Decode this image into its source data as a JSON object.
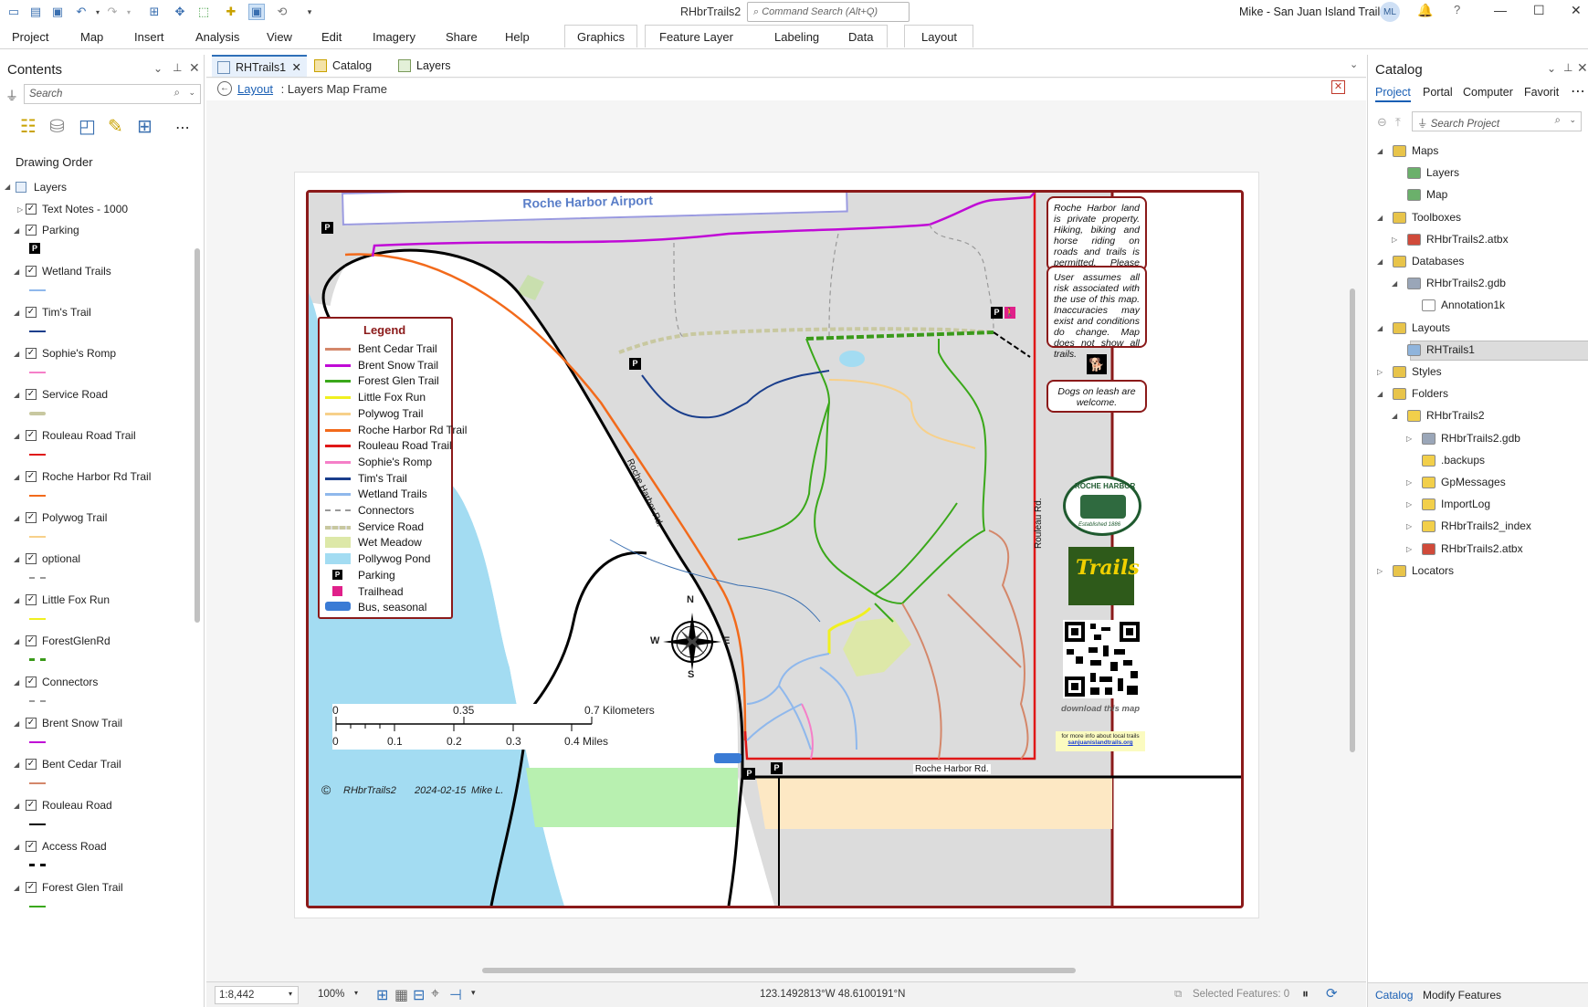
{
  "window": {
    "app_title": "RHbrTrails2",
    "command_search_placeholder": "Command Search (Alt+Q)",
    "user_title": "Mike - San Juan Island Trails",
    "avatar_initials": "ML"
  },
  "ribbon": {
    "tabs": [
      "Project",
      "Map",
      "Insert",
      "Analysis",
      "View",
      "Edit",
      "Imagery",
      "Share",
      "Help"
    ],
    "context_tabs": [
      "Graphics",
      "Feature Layer",
      "Labeling",
      "Data",
      "Layout"
    ]
  },
  "contents": {
    "title": "Contents",
    "search_placeholder": "Search",
    "drawing_order_label": "Drawing Order",
    "root_layer": "Layers",
    "layers": [
      {
        "name": "Text Notes - 1000",
        "symbol": "none",
        "color": ""
      },
      {
        "name": "Parking",
        "symbol": "parking",
        "color": "#000000"
      },
      {
        "name": "Wetland Trails",
        "symbol": "line",
        "color": "#8fb8ec"
      },
      {
        "name": "Tim's Trail",
        "symbol": "line",
        "color": "#1a3e8c"
      },
      {
        "name": "Sophie's Romp",
        "symbol": "line",
        "color": "#f57fc8"
      },
      {
        "name": "Service Road",
        "symbol": "thick",
        "color": "#c8c8a0"
      },
      {
        "name": "Rouleau Road Trail",
        "symbol": "line",
        "color": "#e01818"
      },
      {
        "name": "Roche Harbor Rd Trail",
        "symbol": "line",
        "color": "#f26a1b"
      },
      {
        "name": "Polywog Trail",
        "symbol": "line",
        "color": "#f7d08a"
      },
      {
        "name": "optional",
        "symbol": "dash",
        "color": "#999999"
      },
      {
        "name": "Little Fox Run",
        "symbol": "line",
        "color": "#f0f020"
      },
      {
        "name": "ForestGlenRd",
        "symbol": "dashthick",
        "color": "#3a9a1a"
      },
      {
        "name": "Connectors",
        "symbol": "dash",
        "color": "#999999"
      },
      {
        "name": "Brent Snow Trail",
        "symbol": "line",
        "color": "#c00ad6"
      },
      {
        "name": "Bent Cedar Trail",
        "symbol": "line",
        "color": "#d4876a"
      },
      {
        "name": "Rouleau Road",
        "symbol": "line",
        "color": "#000000"
      },
      {
        "name": "Access Road",
        "symbol": "dashthick",
        "color": "#000000"
      },
      {
        "name": "Forest Glen Trail",
        "symbol": "line",
        "color": "#3aa81a"
      }
    ]
  },
  "map_tabs": [
    {
      "label": "RHTrails1",
      "active": true
    },
    {
      "label": "Catalog",
      "active": false
    },
    {
      "label": "Layers",
      "active": false
    }
  ],
  "breadcrumb": {
    "link": "Layout",
    "rest": " : Layers Map Frame"
  },
  "map": {
    "airport_label": "Roche Harbor Airport",
    "legend_title": "Legend",
    "legend_items": [
      {
        "label": "Bent Cedar Trail",
        "color": "#d4876a",
        "symbol": "line"
      },
      {
        "label": "Brent Snow Trail",
        "color": "#c00ad6",
        "symbol": "line"
      },
      {
        "label": "Forest Glen Trail",
        "color": "#3aa81a",
        "symbol": "line"
      },
      {
        "label": "Little Fox Run",
        "color": "#f0f020",
        "symbol": "line"
      },
      {
        "label": "Polywog Trail",
        "color": "#f7d08a",
        "symbol": "line"
      },
      {
        "label": "Roche Harbor Rd Trail",
        "color": "#f26a1b",
        "symbol": "line"
      },
      {
        "label": "Rouleau Road Trail",
        "color": "#e01818",
        "symbol": "line"
      },
      {
        "label": "Sophie's Romp",
        "color": "#f57fc8",
        "symbol": "line"
      },
      {
        "label": "Tim's Trail",
        "color": "#1a3e8c",
        "symbol": "line"
      },
      {
        "label": "Wetland Trails",
        "color": "#8fb8ec",
        "symbol": "line"
      },
      {
        "label": "Connectors",
        "color": "#999999",
        "symbol": "dash"
      },
      {
        "label": "Service Road",
        "color": "#c8c8a0",
        "symbol": "thick"
      },
      {
        "label": "Wet Meadow",
        "color": "#dde8a8",
        "symbol": "fill"
      },
      {
        "label": "Pollywog Pond",
        "color": "#a3dcf2",
        "symbol": "fill"
      },
      {
        "label": "Parking",
        "color": "#000000",
        "symbol": "parking"
      },
      {
        "label": "Trailhead",
        "color": "#e0208a",
        "symbol": "trailhead"
      },
      {
        "label": "Bus, seasonal",
        "color": "#3a7bd5",
        "symbol": "bus"
      }
    ],
    "road_label_1": "Roche Harbor Rd.",
    "road_label_2": "Rouleau Rd.",
    "road_label_3": "Roche Harbor Rd.",
    "compass": {
      "n": "N",
      "s": "S",
      "e": "E",
      "w": "W"
    },
    "scale_km": {
      "zero": "0",
      "mid": "0.35",
      "end": "0.7 Kilometers"
    },
    "scale_mi": {
      "zero": "0",
      "t1": "0.1",
      "t2": "0.2",
      "t3": "0.3",
      "end": "0.4 Miles"
    },
    "credit": {
      "symbol": "©",
      "name": "RHbrTrails2",
      "date": "2024-02-15",
      "author": "Mike L."
    },
    "notes": [
      "Roche Harbor land is private property. Hiking, biking and horse riding on roads and trails is permitted. Please be respectful.",
      "User assumes all risk associated with the use of this map. Inaccuracies may exist and conditions do change. Map does not show all trails.",
      "Dogs on leash are welcome."
    ],
    "seal_text_top": "ROCHE HARBOR",
    "seal_text_bottom": "Established 1886",
    "trails_logo": "Trails",
    "qr_caption": "download this map",
    "info_line1": "for more info about local trails",
    "info_link": "sanjuanislandtrails.org",
    "parking_letter": "P"
  },
  "catalog": {
    "title": "Catalog",
    "tabs": [
      "Project",
      "Portal",
      "Computer",
      "Favorit"
    ],
    "search_placeholder": "Search Project",
    "tree": [
      {
        "label": "Maps",
        "depth": 0,
        "exp": "open",
        "icon": "folder"
      },
      {
        "label": "Layers",
        "depth": 1,
        "exp": "none",
        "icon": "map"
      },
      {
        "label": "Map",
        "depth": 1,
        "exp": "none",
        "icon": "map"
      },
      {
        "label": "Toolboxes",
        "depth": 0,
        "exp": "open",
        "icon": "folder"
      },
      {
        "label": "RHbrTrails2.atbx",
        "depth": 1,
        "exp": "closed",
        "icon": "toolbox"
      },
      {
        "label": "Databases",
        "depth": 0,
        "exp": "open",
        "icon": "folder"
      },
      {
        "label": "RHbrTrails2.gdb",
        "depth": 1,
        "exp": "open",
        "icon": "gdb"
      },
      {
        "label": "Annotation1k",
        "depth": 2,
        "exp": "none",
        "icon": "anno"
      },
      {
        "label": "Layouts",
        "depth": 0,
        "exp": "open",
        "icon": "folder"
      },
      {
        "label": "RHTrails1",
        "depth": 1,
        "exp": "none",
        "icon": "layout",
        "selected": true
      },
      {
        "label": "Styles",
        "depth": 0,
        "exp": "closed",
        "icon": "folder"
      },
      {
        "label": "Folders",
        "depth": 0,
        "exp": "open",
        "icon": "folder"
      },
      {
        "label": "RHbrTrails2",
        "depth": 1,
        "exp": "open",
        "icon": "yfolder"
      },
      {
        "label": "RHbrTrails2.gdb",
        "depth": 2,
        "exp": "closed",
        "icon": "gdb"
      },
      {
        "label": ".backups",
        "depth": 2,
        "exp": "none",
        "icon": "yfolder"
      },
      {
        "label": "GpMessages",
        "depth": 2,
        "exp": "closed",
        "icon": "yfolder"
      },
      {
        "label": "ImportLog",
        "depth": 2,
        "exp": "closed",
        "icon": "yfolder"
      },
      {
        "label": "RHbrTrails2_index",
        "depth": 2,
        "exp": "closed",
        "icon": "yfolder"
      },
      {
        "label": "RHbrTrails2.atbx",
        "depth": 2,
        "exp": "closed",
        "icon": "toolbox"
      },
      {
        "label": "Locators",
        "depth": 0,
        "exp": "closed",
        "icon": "folder"
      }
    ],
    "bottom_tabs": [
      "Catalog",
      "Modify Features"
    ]
  },
  "status": {
    "scale": "1:8,442",
    "zoom": "100%",
    "coords": "123.1492813°W 48.6100191°N",
    "selected": "Selected Features: 0"
  }
}
